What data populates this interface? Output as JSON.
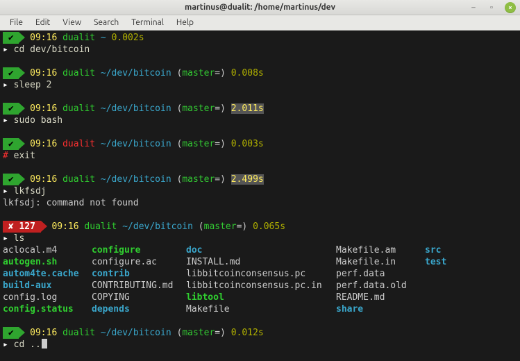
{
  "titlebar": {
    "text": "martinus@dualit: /home/martinus/dev"
  },
  "menubar": {
    "items": [
      "File",
      "Edit",
      "View",
      "Search",
      "Terminal",
      "Help"
    ]
  },
  "blocks": [
    {
      "status": "ok",
      "code": "✔",
      "time": "09:16",
      "host": "dualit",
      "path": "~",
      "branch": null,
      "dur": "0.002s",
      "prompt": "▸",
      "cmd": "cd dev/bitcoin",
      "output": null
    },
    {
      "status": "ok",
      "code": "✔",
      "time": "09:16",
      "host": "dualit",
      "path": "~/dev/bitcoin",
      "branch": "master",
      "dur": "0.008s",
      "prompt": "▸",
      "cmd": "sleep 2",
      "output": null
    },
    {
      "status": "ok",
      "code": "✔",
      "time": "09:16",
      "host": "dualit",
      "path": "~/dev/bitcoin",
      "branch": "master",
      "dur": "2.011s",
      "dur_hi": true,
      "prompt": "▸",
      "cmd": "sudo bash",
      "output": null
    },
    {
      "status": "ok",
      "code": "✔",
      "time": "09:16",
      "host": "dualit",
      "host_root": true,
      "path": "~/dev/bitcoin",
      "branch": "master",
      "dur": "0.003s",
      "prompt": "#",
      "cmd": "exit",
      "output": null
    },
    {
      "status": "ok",
      "code": "✔",
      "time": "09:16",
      "host": "dualit",
      "path": "~/dev/bitcoin",
      "branch": "master",
      "dur": "2.499s",
      "dur_hi": true,
      "prompt": "▸",
      "cmd": "lkfsdj",
      "output": "lkfsdj: command not found"
    },
    {
      "status": "err",
      "code": "✘ 127",
      "time": "09:16",
      "host": "dualit",
      "path": "~/dev/bitcoin",
      "branch": "master",
      "dur": "0.065s",
      "prompt": "▸",
      "cmd": "ls",
      "ls": true
    },
    {
      "status": "ok",
      "code": "✔",
      "time": "09:16",
      "host": "dualit",
      "path": "~/dev/bitcoin",
      "branch": "master",
      "dur": "0.012s",
      "prompt": "▸",
      "cmd": "cd ..",
      "cursor": true
    }
  ],
  "ls_rows": [
    [
      {
        "t": "aclocal.m4",
        "c": "plain"
      },
      {
        "t": "configure",
        "c": "green"
      },
      {
        "t": "doc",
        "c": "blue"
      },
      {
        "t": "Makefile.am",
        "c": "plain"
      },
      {
        "t": "src",
        "c": "blue"
      }
    ],
    [
      {
        "t": "autogen.sh",
        "c": "green"
      },
      {
        "t": "configure.ac",
        "c": "plain"
      },
      {
        "t": "INSTALL.md",
        "c": "plain"
      },
      {
        "t": "Makefile.in",
        "c": "plain"
      },
      {
        "t": "test",
        "c": "blue"
      }
    ],
    [
      {
        "t": "autom4te.cache",
        "c": "blue"
      },
      {
        "t": "contrib",
        "c": "blue"
      },
      {
        "t": "libbitcoinconsensus.pc",
        "c": "plain"
      },
      {
        "t": "perf.data",
        "c": "plain"
      },
      {
        "t": "",
        "c": ""
      }
    ],
    [
      {
        "t": "build-aux",
        "c": "blue"
      },
      {
        "t": "CONTRIBUTING.md",
        "c": "plain"
      },
      {
        "t": "libbitcoinconsensus.pc.in",
        "c": "plain"
      },
      {
        "t": "perf.data.old",
        "c": "plain"
      },
      {
        "t": "",
        "c": ""
      }
    ],
    [
      {
        "t": "config.log",
        "c": "plain"
      },
      {
        "t": "COPYING",
        "c": "plain"
      },
      {
        "t": "libtool",
        "c": "green"
      },
      {
        "t": "README.md",
        "c": "plain"
      },
      {
        "t": "",
        "c": ""
      }
    ],
    [
      {
        "t": "config.status",
        "c": "green"
      },
      {
        "t": "depends",
        "c": "blue"
      },
      {
        "t": "Makefile",
        "c": "plain"
      },
      {
        "t": "share",
        "c": "blue"
      },
      {
        "t": "",
        "c": ""
      }
    ]
  ]
}
